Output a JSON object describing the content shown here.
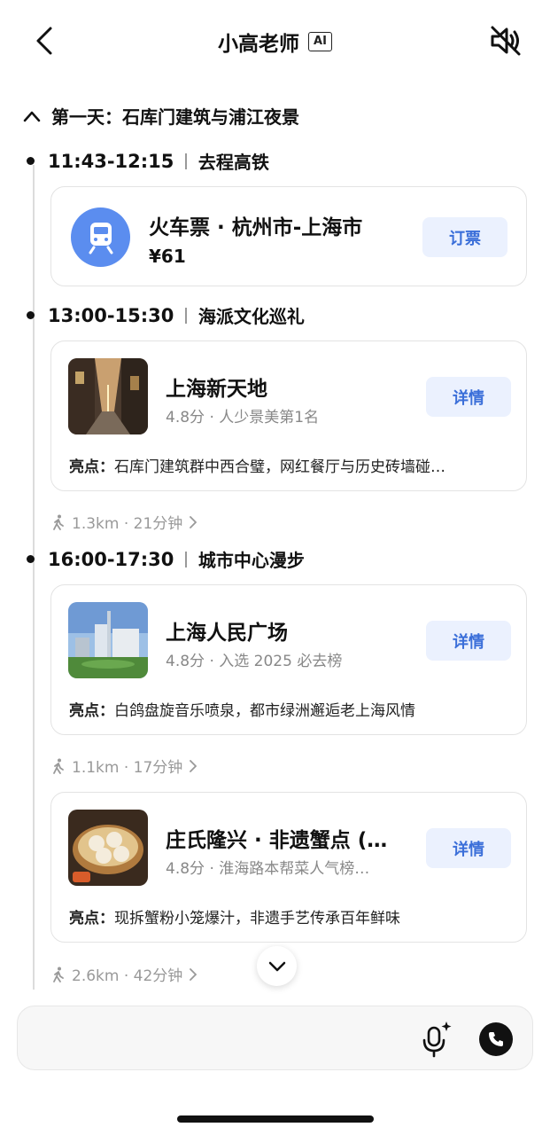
{
  "header": {
    "title": "小高老师",
    "badge": "AI"
  },
  "day": {
    "title": "第一天：石库门建筑与浦江夜景"
  },
  "slots": [
    {
      "time": "11:43-12:15",
      "name": "去程高铁"
    },
    {
      "time": "13:00-15:30",
      "name": "海派文化巡礼"
    },
    {
      "time": "16:00-17:30",
      "name": "城市中心漫步"
    }
  ],
  "train": {
    "title": "火车票 · 杭州市-上海市",
    "price": "¥61",
    "button": "订票"
  },
  "places": [
    {
      "title": "上海新天地",
      "sub": "4.8分 · 人少景美第1名",
      "hl_label": "亮点：",
      "hl_text": "石库门建筑群中西合璧，网红餐厅与历史砖墙碰…",
      "button": "详情"
    },
    {
      "title": "上海人民广场",
      "sub": "4.8分 · 入选 2025 必去榜",
      "hl_label": "亮点：",
      "hl_text": "白鸽盘旋音乐喷泉，都市绿洲邂逅老上海风情",
      "button": "详情"
    },
    {
      "title": "庄氏隆兴 · 非遗蟹点 (…",
      "sub": "4.8分 · 淮海路本帮菜人气榜…",
      "hl_label": "亮点：",
      "hl_text": "现拆蟹粉小笼爆汁，非遗手艺传承百年鲜味",
      "button": "详情"
    }
  ],
  "walks": [
    {
      "text": "1.3km · 21分钟"
    },
    {
      "text": "1.1km · 17分钟"
    },
    {
      "text": "2.6km · 42分钟"
    }
  ],
  "icons": {
    "back": "chevron-left-icon",
    "mute": "speaker-muted-icon",
    "collapse": "chevron-up-icon",
    "train": "train-icon",
    "walk": "walking-person-icon",
    "expand": "chevron-down-icon",
    "mic": "mic-sparkle-icon",
    "call": "phone-icon"
  },
  "colors": {
    "accent": "#3b6fd9",
    "button_bg": "#ebf1fe",
    "train_circle": "#5b8def"
  }
}
